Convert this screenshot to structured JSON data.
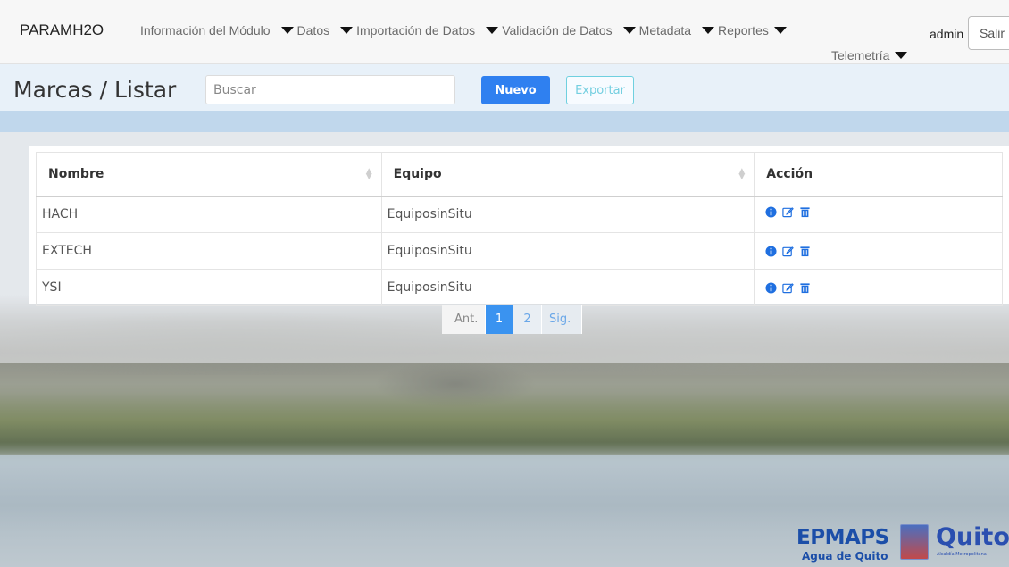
{
  "navbar": {
    "brand": "PARAMH2O",
    "items": [
      {
        "label": "Información del Módulo"
      },
      {
        "label": "Datos"
      },
      {
        "label": "Importación de Datos"
      },
      {
        "label": "Validación de Datos"
      },
      {
        "label": "Metadata"
      },
      {
        "label": "Reportes"
      }
    ],
    "telemetria": "Telemetría",
    "user": "admin",
    "logout": "Salir"
  },
  "toolbar": {
    "title": "Marcas / Listar",
    "search_placeholder": "Buscar",
    "new_label": "Nuevo",
    "export_label": "Exportar"
  },
  "table": {
    "columns": [
      "Nombre",
      "Equipo",
      "Acción"
    ],
    "rows": [
      {
        "nombre": "HACH",
        "equipo": "EquiposinSitu"
      },
      {
        "nombre": "EXTECH",
        "equipo": "EquiposinSitu"
      },
      {
        "nombre": "YSI",
        "equipo": "EquiposinSitu"
      }
    ],
    "action_icons": [
      "info-icon",
      "edit-icon",
      "trash-icon"
    ]
  },
  "pagination": {
    "prev": "Ant.",
    "pages": [
      "1",
      "2"
    ],
    "current": "1",
    "next": "Sig."
  },
  "logo": {
    "name": "EPMAPS",
    "tagline": "Agua de Quito",
    "city": "Quito",
    "city_sub": "Alcaldía Metropolitana"
  },
  "colors": {
    "primary": "#2f80f0",
    "accent_outline": "#6fd0df",
    "icon_blue": "#1f6fe0"
  }
}
